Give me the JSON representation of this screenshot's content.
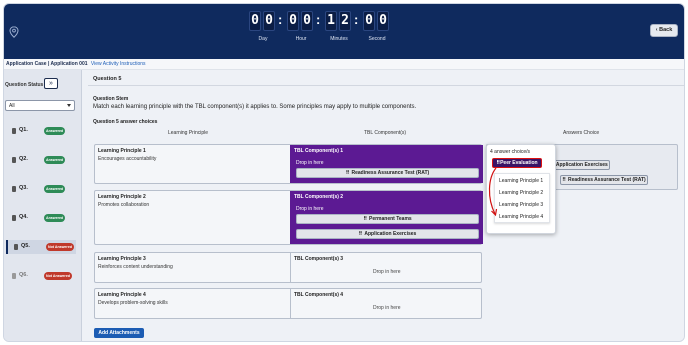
{
  "timer": {
    "digits": [
      "0",
      "0",
      "0",
      "0",
      "1",
      "2",
      "0",
      "0"
    ],
    "labels": [
      "Day",
      "Hour",
      "Minutes",
      "Second"
    ]
  },
  "header": {
    "back_label": "Back"
  },
  "breadcrumb": {
    "title": "Application Case | Application 001",
    "link": "View Activity Instructions"
  },
  "sidebar": {
    "title": "Question Status",
    "filter_value": "All",
    "items": [
      {
        "label": "Q1.",
        "status": "Answered"
      },
      {
        "label": "Q2.",
        "status": "Answered"
      },
      {
        "label": "Q3.",
        "status": "Answered"
      },
      {
        "label": "Q4.",
        "status": "Answered"
      },
      {
        "label": "Q5.",
        "status": "Not Answered"
      },
      {
        "label": "Q6.",
        "status": "Not Answered"
      }
    ]
  },
  "question": {
    "heading": "Question 5",
    "stem_title": "Question Stem",
    "stem_text": "Match each learning principle with the TBL component(s) it applies to. Some principles may apply to multiple components.",
    "answers_title": "Question 5 answer choices",
    "col_lp": "Learning Principle",
    "col_tbl": "TBL Component(s)",
    "col_ans": "Answers Choice",
    "drop_here": "Drop in here",
    "rows": [
      {
        "title": "Learning Principle 1",
        "text": "Encourages accountability",
        "tbl": "TBL Component(s) 1",
        "chips": [
          "Readiness Assurance Test (RAT)"
        ]
      },
      {
        "title": "Learning Principle 2",
        "text": "Promotes collaboration",
        "tbl": "TBL Component(s) 2",
        "chips": [
          "Permanent Teams",
          "Application Exercises"
        ]
      },
      {
        "title": "Learning Principle 3",
        "text": "Reinforces content understanding",
        "tbl": "TBL Component(s) 3",
        "chips": []
      },
      {
        "title": "Learning Principle 4",
        "text": "Develops problem-solving skills",
        "tbl": "TBL Component(s) 4",
        "chips": []
      }
    ],
    "add_attachments": "Add Attachments"
  },
  "answers_panel": {
    "chips": [
      "Application Exercises",
      "Readiness Assurance Test (RAT)"
    ]
  },
  "popup": {
    "count": "4 answer choice/s",
    "selected": "Peer Evaluation",
    "menu": [
      "Learning Principle 1",
      "Learning Principle 2",
      "Learning Principle 3",
      "Learning Principle 4"
    ]
  },
  "colors": {
    "header_bg": "#0f2a5e",
    "filled_zone": "#5c1a93",
    "answered_badge": "#2e8b57",
    "not_answered_badge": "#c0392b",
    "primary_button": "#1c5cb3",
    "highlight_border": "#d11111"
  },
  "icons": [
    "location-pin-icon",
    "chevron-left-icon",
    "double-chevron-right-icon",
    "caret-down-icon",
    "drag-grip-icon",
    "document-icon",
    "curved-arrow-icon"
  ]
}
